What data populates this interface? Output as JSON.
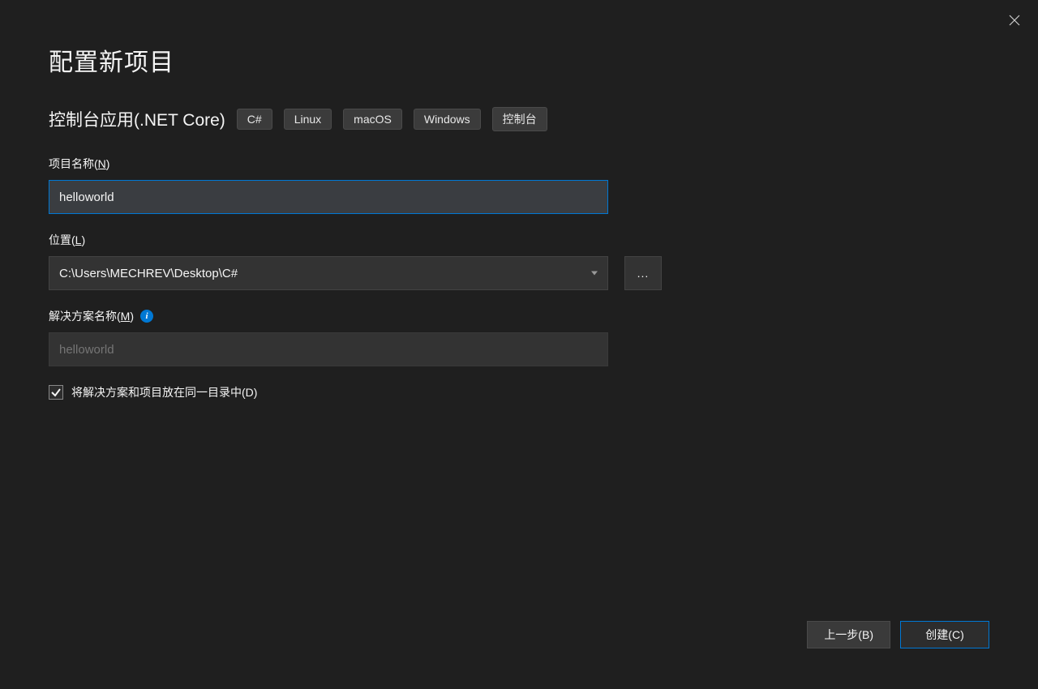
{
  "header": {
    "title": "配置新项目"
  },
  "subtitle": {
    "text": "控制台应用(.NET Core)",
    "tags": [
      "C#",
      "Linux",
      "macOS",
      "Windows",
      "控制台"
    ]
  },
  "fields": {
    "projectName": {
      "label": "项目名称(",
      "hotkey": "N",
      "labelEnd": ")",
      "value": "helloworld"
    },
    "location": {
      "label": "位置(",
      "hotkey": "L",
      "labelEnd": ")",
      "value": "C:\\Users\\MECHREV\\Desktop\\C#",
      "browseText": "..."
    },
    "solutionName": {
      "label": "解决方案名称(",
      "hotkey": "M",
      "labelEnd": ")",
      "placeholder": "helloworld"
    },
    "sameDirectory": {
      "label": "将解决方案和项目放在同一目录中(",
      "hotkey": "D",
      "labelEnd": ")",
      "checked": true
    }
  },
  "footer": {
    "back": "上一步(",
    "backHotkey": "B",
    "backEnd": ")",
    "create": "创建(",
    "createHotkey": "C",
    "createEnd": ")"
  }
}
